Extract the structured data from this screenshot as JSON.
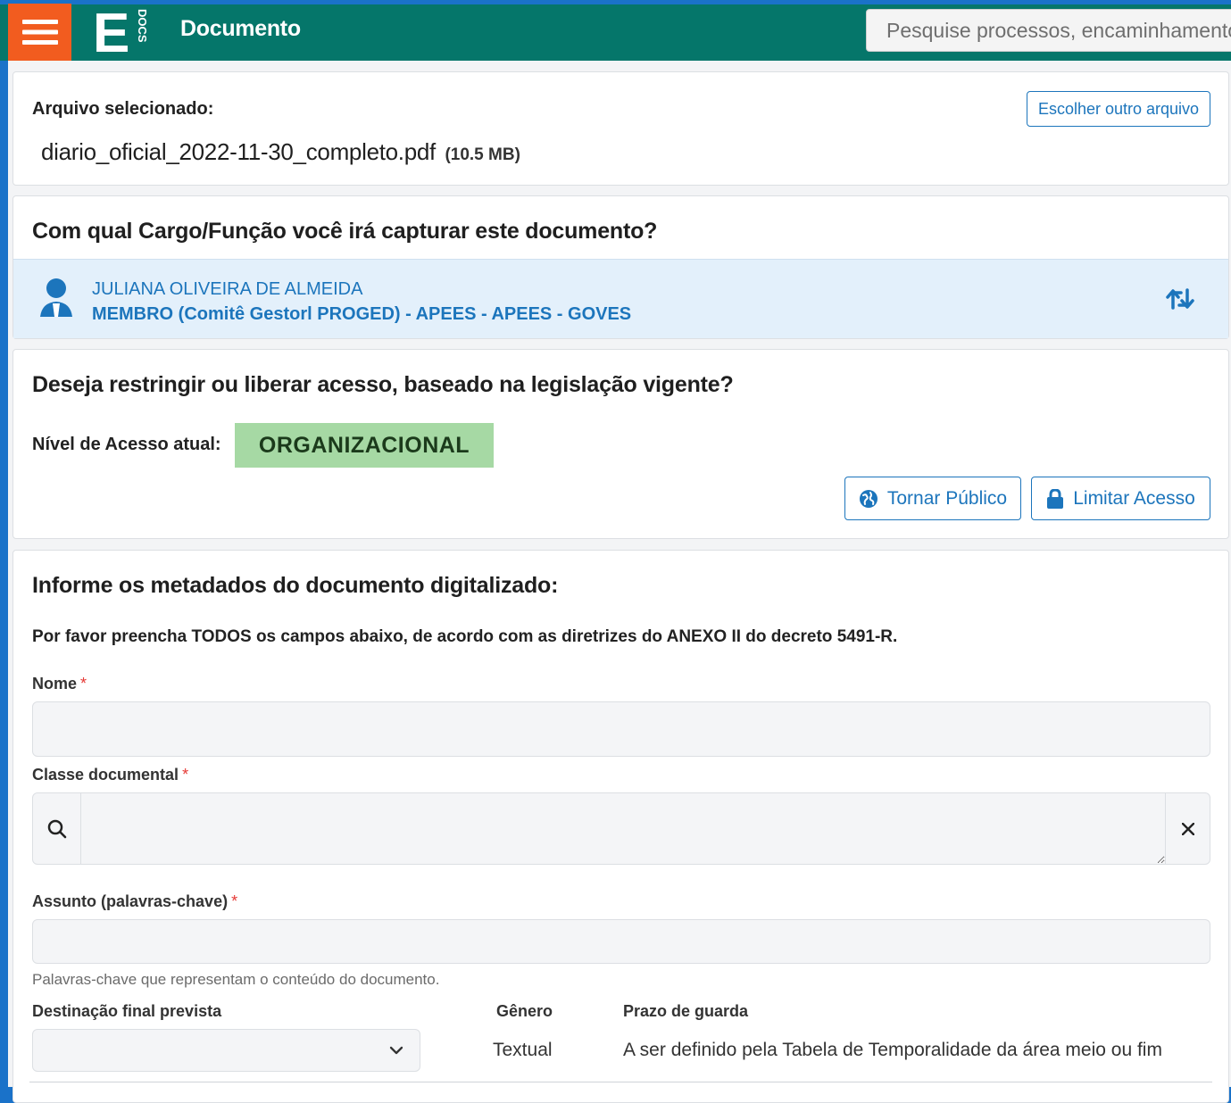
{
  "header": {
    "title": "Documento",
    "search_placeholder": "Pesquise processos, encaminhamentos",
    "logo_letter": "E",
    "logo_sub": "DOCS"
  },
  "file": {
    "label": "Arquivo selecionado:",
    "name": "diario_oficial_2022-11-30_completo.pdf",
    "size": "(10.5 MB)",
    "change_button": "Escolher outro arquivo"
  },
  "role": {
    "question": "Com qual Cargo/Função você irá capturar este documento?",
    "person": "JULIANA OLIVEIRA DE ALMEIDA",
    "position": "MEMBRO (Comitê Gestorl PROGED) - APEES - APEES - GOVES"
  },
  "access": {
    "question": "Deseja restringir ou liberar acesso, baseado na legislação vigente?",
    "level_label": "Nível de Acesso atual:",
    "level_value": "ORGANIZACIONAL",
    "public_button": "Tornar Público",
    "limit_button": "Limitar Acesso"
  },
  "metadata": {
    "title": "Informe os metadados do documento digitalizado:",
    "instructions": "Por favor preencha TODOS os campos abaixo, de acordo com as diretrizes do ANEXO II do decreto 5491-R.",
    "required_mark": "*",
    "fields": {
      "nome_label": "Nome",
      "classe_label": "Classe documental",
      "assunto_label": "Assunto (palavras-chave)",
      "assunto_help": "Palavras-chave que representam o conteúdo do documento.",
      "destinacao_label": "Destinação final prevista",
      "genero_label": "Gênero",
      "genero_value": "Textual",
      "prazo_label": "Prazo de guarda",
      "prazo_value": "A ser definido pela Tabela de Temporalidade da área meio ou fim"
    }
  },
  "colors": {
    "header_bg": "#05766a",
    "menu_bg": "#f25c1f",
    "accent": "#1c75bc",
    "badge_bg": "#a6d9a4",
    "role_bg": "#e3f0fb"
  }
}
